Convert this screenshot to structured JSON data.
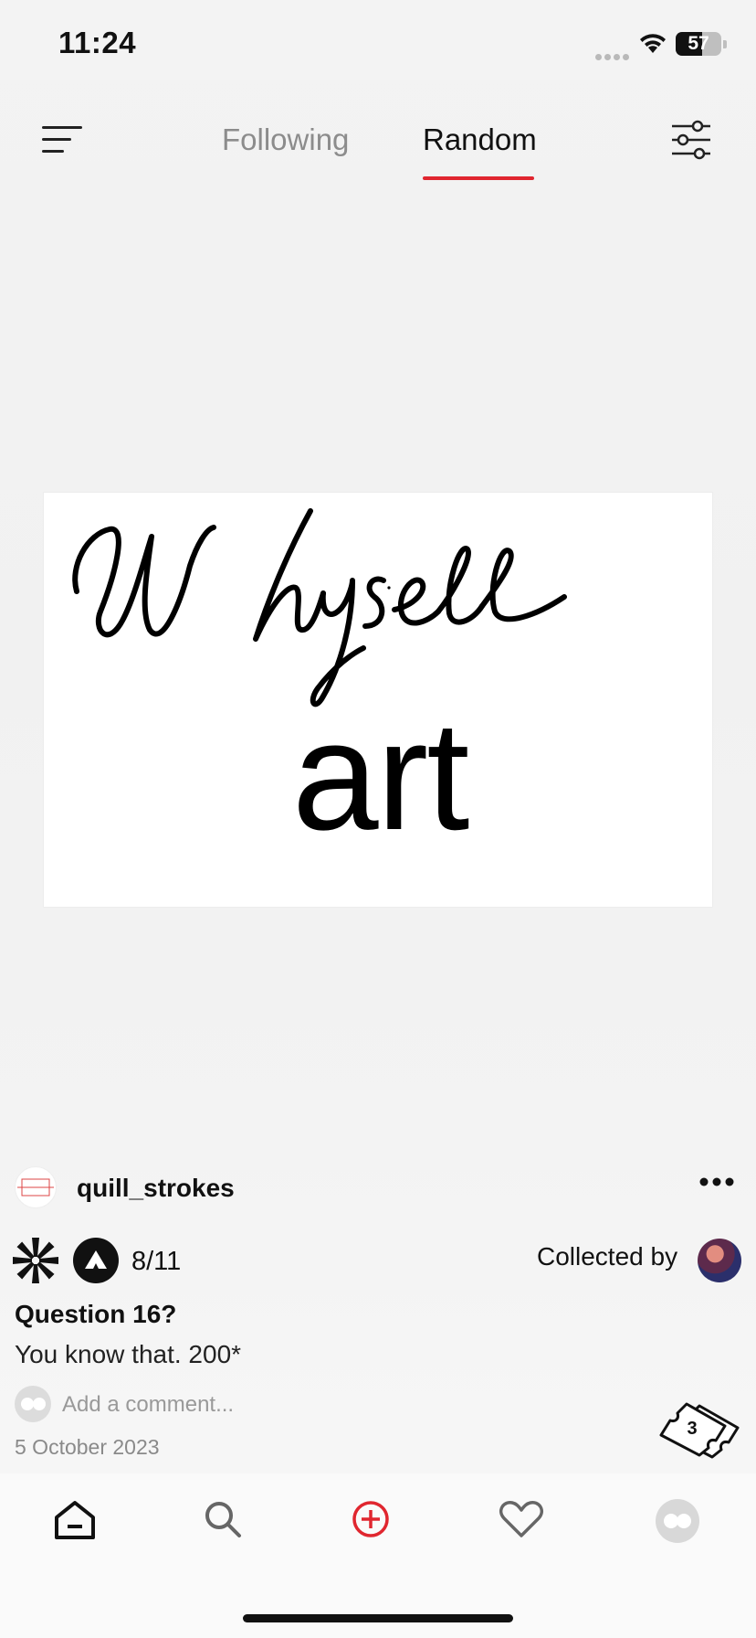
{
  "status_bar": {
    "time": "11:24",
    "battery_percent": 57
  },
  "top_nav": {
    "tabs": [
      {
        "label": "Following",
        "active": false
      },
      {
        "label": "Random",
        "active": true
      }
    ],
    "accent_color": "#e0262f"
  },
  "artwork": {
    "text_lines": [
      "Whysell",
      "art"
    ]
  },
  "post": {
    "username": "quill_strokes",
    "edition_count": "8/11",
    "collected_by_label": "Collected by",
    "title": "Question 16?",
    "description": "You know that. 200*",
    "comment_placeholder": "Add a comment...",
    "date": "5 October 2023",
    "ticket_count": "3"
  },
  "bottom_nav": {
    "items": [
      {
        "icon": "home-icon",
        "active": true
      },
      {
        "icon": "search-icon"
      },
      {
        "icon": "add-icon",
        "color": "#e0262f"
      },
      {
        "icon": "heart-icon"
      },
      {
        "icon": "profile-avatar"
      }
    ]
  }
}
